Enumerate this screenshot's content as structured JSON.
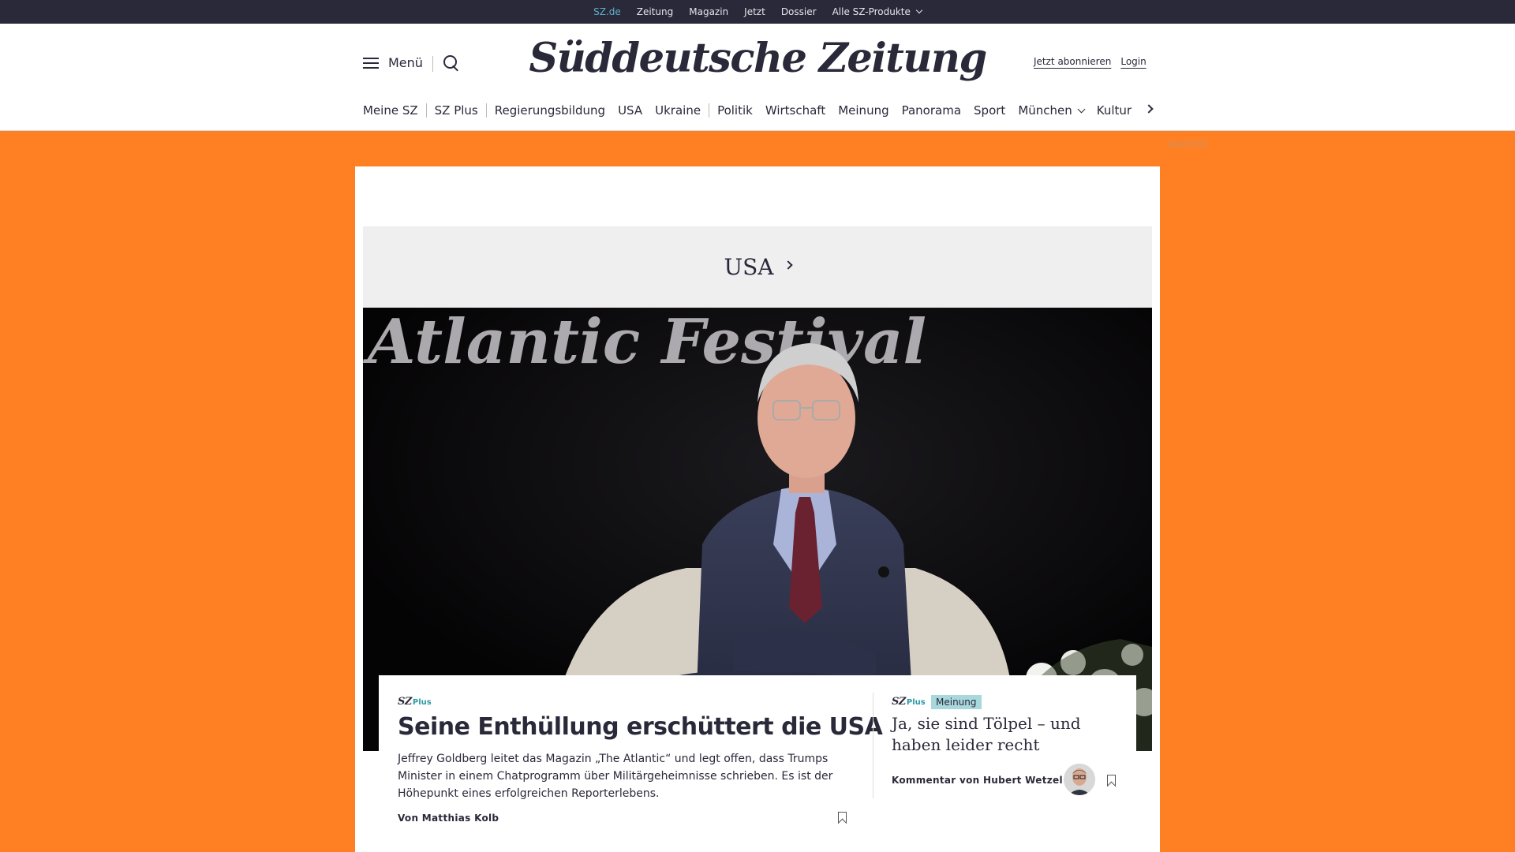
{
  "topbar": {
    "items": [
      "SZ.de",
      "Zeitung",
      "Magazin",
      "Jetzt",
      "Dossier",
      "Alle SZ-Produkte"
    ]
  },
  "header": {
    "menu_label": "Menü",
    "logo": "Süddeutsche Zeitung",
    "subscribe_label": "Jetzt abonnieren",
    "login_label": "Login"
  },
  "categories": [
    "Meine SZ",
    "SZ Plus",
    "Regierungsbildung",
    "USA",
    "Ukraine",
    "Politik",
    "Wirtschaft",
    "Meinung",
    "Panorama",
    "Sport",
    "München",
    "Kultur"
  ],
  "ad_label": "ANZEIGE",
  "section": {
    "title": "USA"
  },
  "hero": {
    "image_text": "Atlantic Festival"
  },
  "main_article": {
    "brand_sz": "SZ",
    "brand_plus": "Plus",
    "title": "Seine Enthüllung erschüttert die USA",
    "teaser": "Jeffrey Goldberg leitet das Magazin „The Atlantic“ und legt offen, dass Trumps Minister in einem Chatprogramm über Militärgeheimnisse schrieben. Es ist der Höhepunkt eines erfolgreichen Reporterlebens.",
    "author": "Von Matthias Kolb"
  },
  "side_article": {
    "brand_sz": "SZ",
    "brand_plus": "Plus",
    "badge": "Meinung",
    "title": "Ja, sie sind Tölpel – und haben leider recht",
    "author": "Kommentar von Hubert Wetzel"
  },
  "colors": {
    "background": "#ff8022",
    "topbar": "#29293a",
    "text": "#29293a",
    "accent": "#2b9aa6",
    "badge": "#a8d8dc"
  }
}
